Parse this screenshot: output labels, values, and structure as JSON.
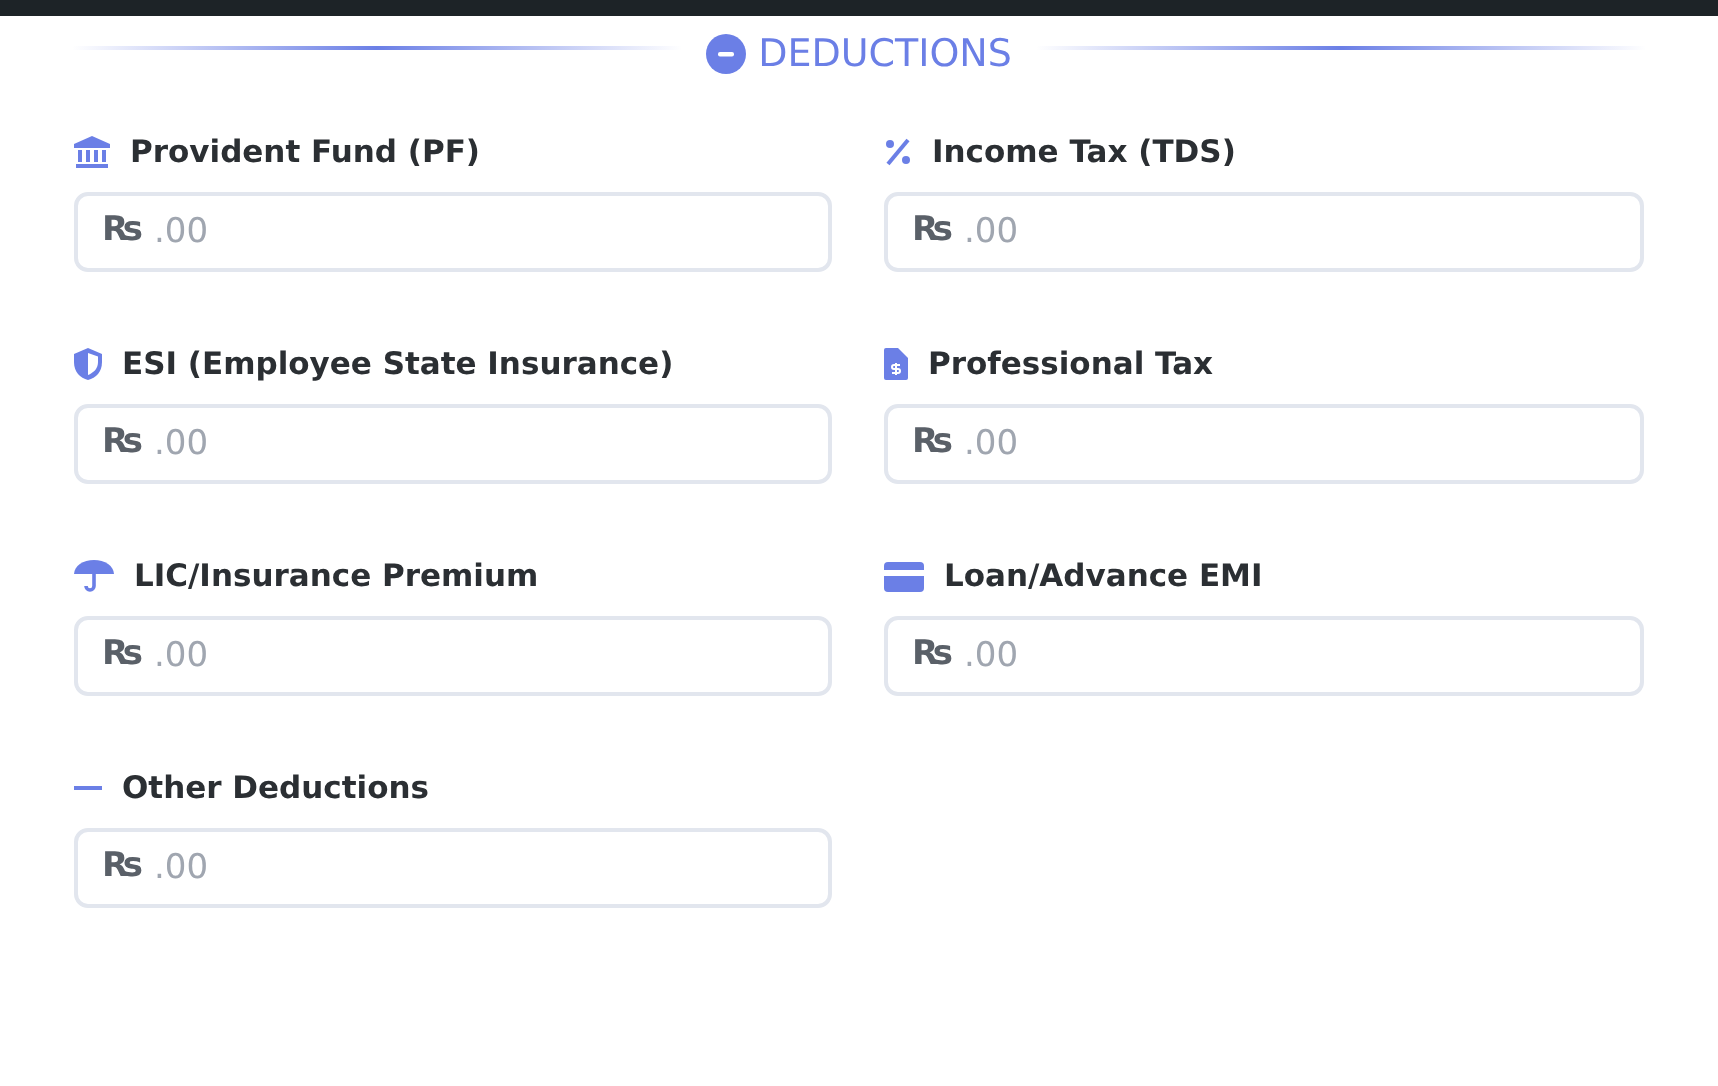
{
  "section": {
    "title": "DEDUCTIONS"
  },
  "fields": [
    {
      "label": "Provident Fund (PF)",
      "prefix": "₨",
      "placeholder": ".00"
    },
    {
      "label": "Income Tax (TDS)",
      "prefix": "₨",
      "placeholder": ".00"
    },
    {
      "label": "ESI (Employee State Insurance)",
      "prefix": "₨",
      "placeholder": ".00"
    },
    {
      "label": "Professional Tax",
      "prefix": "₨",
      "placeholder": ".00"
    },
    {
      "label": "LIC/Insurance Premium",
      "prefix": "₨",
      "placeholder": ".00"
    },
    {
      "label": "Loan/Advance EMI",
      "prefix": "₨",
      "placeholder": ".00"
    },
    {
      "label": "Other Deductions",
      "prefix": "₨",
      "placeholder": ".00"
    }
  ]
}
